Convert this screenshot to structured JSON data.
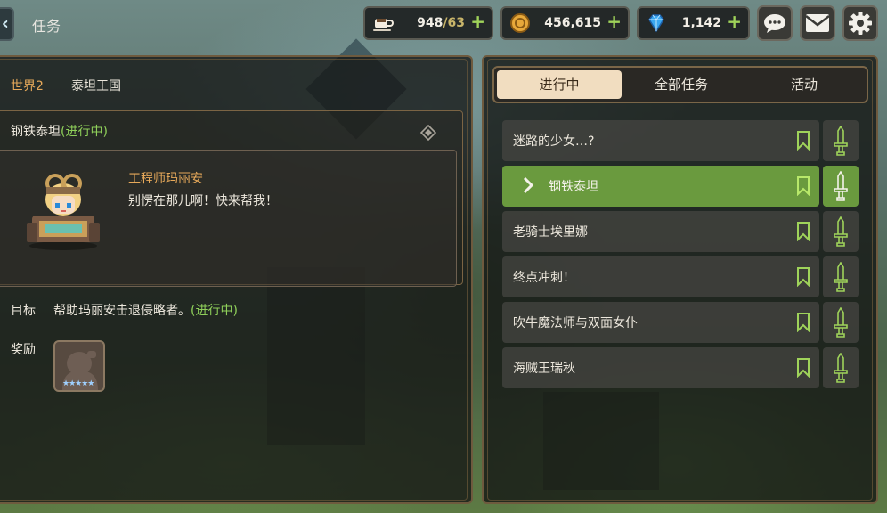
{
  "header": {
    "back_icon": "chevron-left-icon",
    "title": "任务",
    "resources": {
      "stamina": {
        "icon": "coffee-cup-icon",
        "value": "948",
        "max": "/63"
      },
      "gold": {
        "icon": "gold-coin-icon",
        "value": "456,615"
      },
      "gems": {
        "icon": "blue-gem-icon",
        "value": "1,142"
      }
    },
    "buttons": [
      "chat-bubble-icon",
      "mail-icon",
      "gear-icon"
    ]
  },
  "left": {
    "world_label": "世界2",
    "world_name": "泰坦王国",
    "quest_title": "钢铁泰坦",
    "quest_status": "(进行中)",
    "npc_name": "工程师玛丽安",
    "npc_line": "别愣在那儿啊！快来帮我！",
    "goal_label": "目标",
    "goal_text": "帮助玛丽安击退侵略者。",
    "goal_status": "(进行中)",
    "reward_label": "奖励",
    "reward_stars": "★★★★★"
  },
  "right": {
    "tabs": [
      {
        "label": "进行中",
        "active": true
      },
      {
        "label": "全部任务",
        "active": false
      },
      {
        "label": "活动",
        "active": false
      }
    ],
    "quests": [
      {
        "label": "迷路的少女…?"
      },
      {
        "label": "钢铁泰坦",
        "active": true
      },
      {
        "label": "老骑士埃里娜"
      },
      {
        "label": "终点冲刺！"
      },
      {
        "label": "吹牛魔法师与双面女仆"
      },
      {
        "label": "海贼王瑞秋"
      }
    ]
  },
  "colors": {
    "accent_green": "#6a9a3e",
    "status_green": "#8fd05a",
    "orange_label": "#e7a95a",
    "frame_brown": "#6e5a3e"
  }
}
